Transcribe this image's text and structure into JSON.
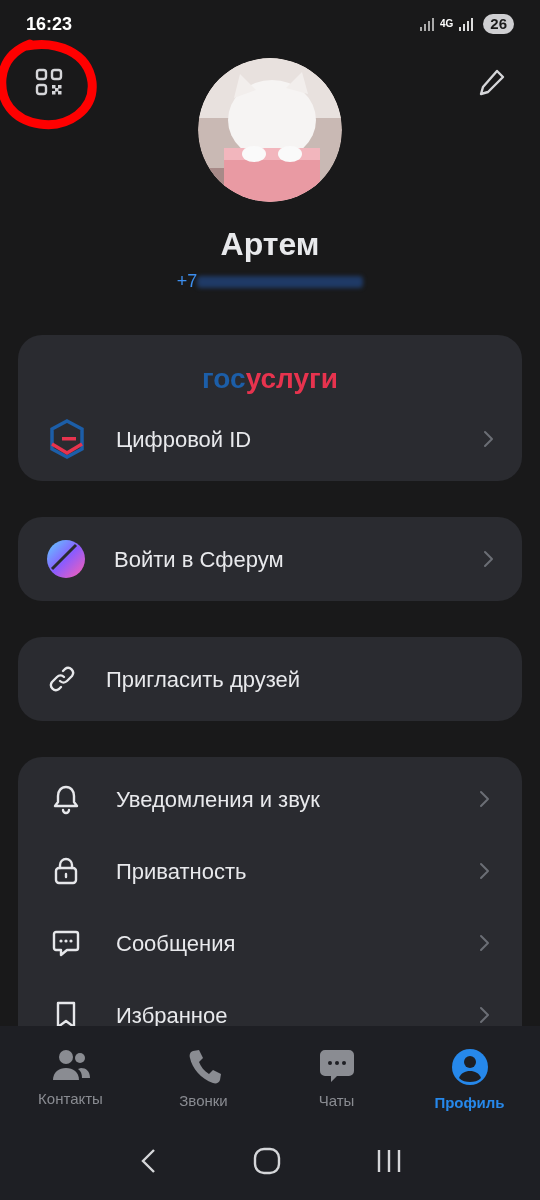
{
  "status_bar": {
    "time": "16:23",
    "network": "4G",
    "battery": "26"
  },
  "profile": {
    "name": "Артем",
    "phone": "+7"
  },
  "gosuslugi": {
    "wordmark": [
      "гос",
      "услуги"
    ],
    "item": "Цифровой ID"
  },
  "cards": [
    {
      "kind": "sferum",
      "label": "Войти в Сферум",
      "chevron": true
    },
    {
      "kind": "invite",
      "label": "Пригласить друзей",
      "chevron": false
    }
  ],
  "settings": [
    {
      "kind": "bell",
      "label": "Уведомления и звук"
    },
    {
      "kind": "lock",
      "label": "Приватность"
    },
    {
      "kind": "message",
      "label": "Сообщения"
    },
    {
      "kind": "bookmark",
      "label": "Избранное"
    }
  ],
  "tabs": [
    {
      "kind": "contacts",
      "label": "Контакты",
      "selected": false
    },
    {
      "kind": "calls",
      "label": "Звонки",
      "selected": false
    },
    {
      "kind": "chats",
      "label": "Чаты",
      "selected": false
    },
    {
      "kind": "profile",
      "label": "Профиль",
      "selected": true
    }
  ]
}
